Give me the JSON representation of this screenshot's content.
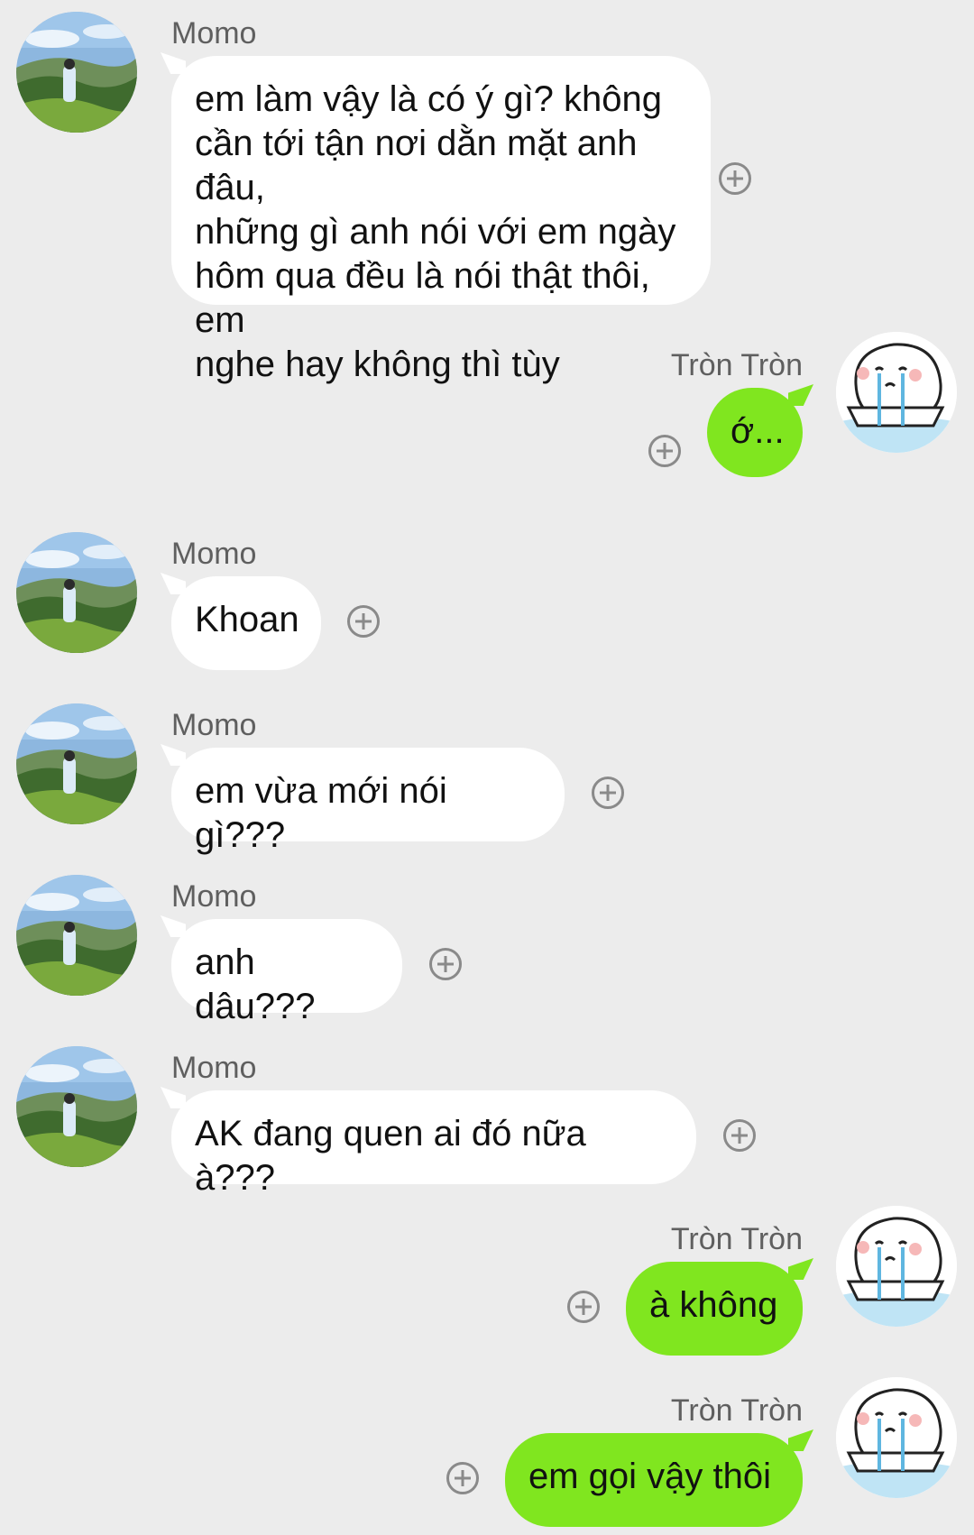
{
  "contacts": {
    "other": "Momo",
    "self": "Tròn Tròn"
  },
  "messages": [
    {
      "sender": "Momo",
      "text": "em làm vậy là có ý gì? không\ncần tới tận nơi dằn mặt anh đâu,\nnhững gì anh nói với em ngày\nhôm qua đều là nói thật thôi, em\nnghe hay không thì tùy"
    },
    {
      "sender": "Tròn Tròn",
      "text": "ớ..."
    },
    {
      "sender": "Momo",
      "text": "Khoan"
    },
    {
      "sender": "Momo",
      "text": "em vừa mới nói gì???"
    },
    {
      "sender": "Momo",
      "text": "anh dâu???"
    },
    {
      "sender": "Momo",
      "text": "AK đang quen ai đó nữa à???"
    },
    {
      "sender": "Tròn Tròn",
      "text": "à không"
    },
    {
      "sender": "Tròn Tròn",
      "text": "em gọi vậy thôi"
    }
  ],
  "icons": {
    "other_avatar": "avatar-photo-tea-hill",
    "self_avatar": "avatar-crying-cartoon",
    "add_reaction": "add-circle-icon"
  },
  "colors": {
    "background": "#ececec",
    "incoming_bubble": "#ffffff",
    "outgoing_bubble": "#80e61f",
    "name_text": "#5f5f5f"
  }
}
